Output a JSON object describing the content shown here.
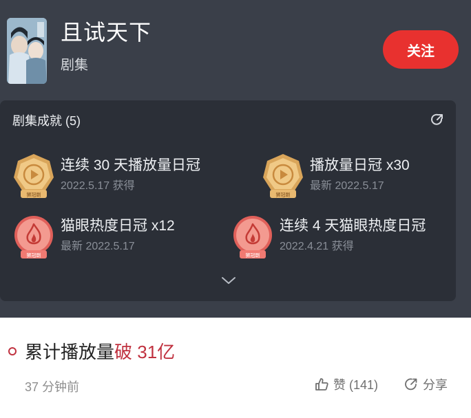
{
  "header": {
    "title": "且试天下",
    "category": "剧集",
    "follow_label": "关注"
  },
  "achievements": {
    "heading": "剧集成就 (5)",
    "items": [
      {
        "name": "连续 30 天播放量日冠",
        "date": "2022.5.17 获得",
        "medal": "play"
      },
      {
        "name": "播放量日冠 x30",
        "date": "最新 2022.5.17",
        "medal": "play"
      },
      {
        "name": "猫眼热度日冠 x12",
        "date": "最新 2022.5.17",
        "medal": "flame"
      },
      {
        "name": "连续 4 天猫眼热度日冠",
        "date": "2022.4.21 获得",
        "medal": "flame"
      }
    ],
    "medal_ribbon_text": "狮冠剧"
  },
  "post": {
    "title_main": "累计播放量",
    "title_highlight": "破 31亿",
    "time_ago": "37 分钟前",
    "like_label": "赞 (141)",
    "share_label": "分享"
  },
  "colors": {
    "dark_bg": "#3a3f49",
    "panel_bg": "#2b2f37",
    "accent_red": "#e8312f",
    "highlight_red": "#c0313f",
    "gold_medal": "#d9a55a",
    "red_medal": "#e0605a"
  }
}
